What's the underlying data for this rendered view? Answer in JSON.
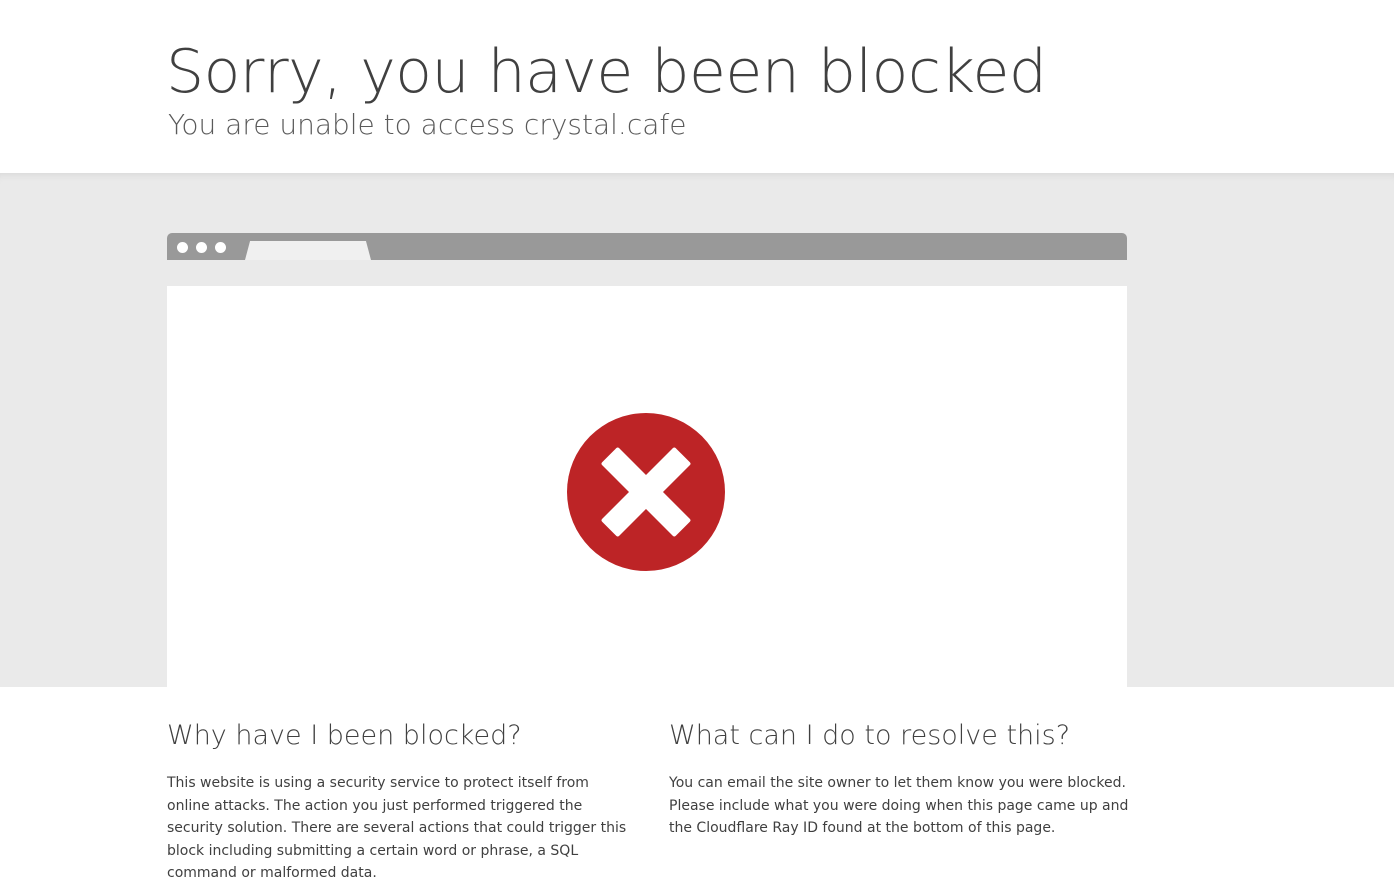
{
  "header": {
    "title": "Sorry, you have been blocked",
    "subtitle": "You are unable to access crystal.cafe"
  },
  "colors": {
    "error_red": "#bd2426",
    "browser_bar": "#999999",
    "band_bg": "#eaeaea",
    "text": "#404040"
  },
  "icons": {
    "error": "x-circle-icon"
  },
  "why": {
    "heading": "Why have I been blocked?",
    "body": "This website is using a security service to protect itself from online attacks. The action you just performed triggered the security solution. There are several actions that could trigger this block including submitting a certain word or phrase, a SQL command or malformed data."
  },
  "resolve": {
    "heading": "What can I do to resolve this?",
    "body": "You can email the site owner to let them know you were blocked. Please include what you were doing when this page came up and the Cloudflare Ray ID found at the bottom of this page."
  }
}
